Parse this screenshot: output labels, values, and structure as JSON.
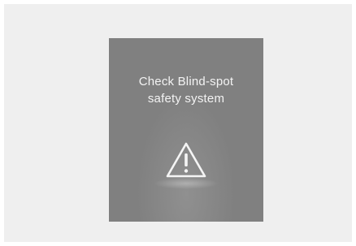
{
  "notification": {
    "message_line1": "Check Blind-spot",
    "message_line2": "safety system",
    "icon": "warning-triangle-icon"
  }
}
